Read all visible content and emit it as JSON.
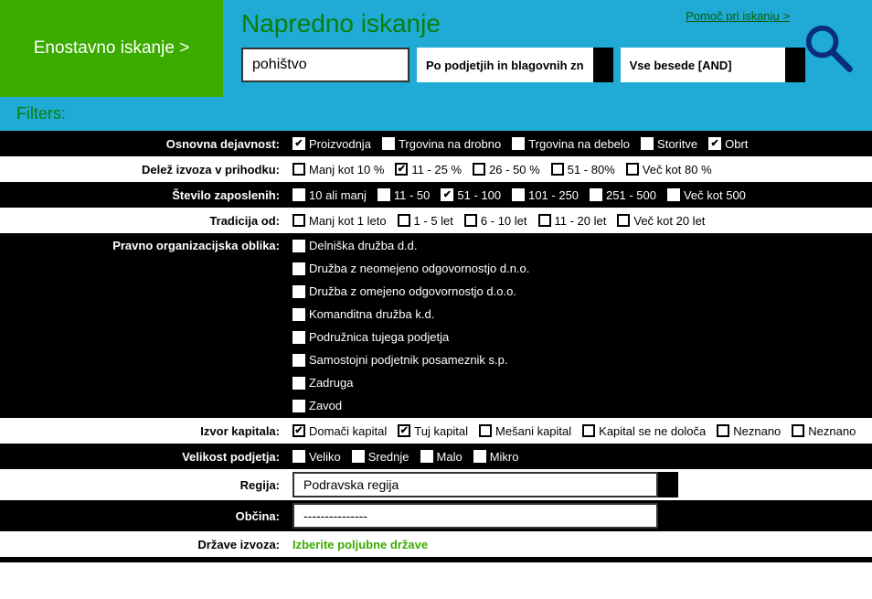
{
  "header": {
    "simple_search": "Enostavno iskanje >",
    "adv_title": "Napredno iskanje",
    "help": "Pomoč pri iskanju >",
    "search_value": "pohištvo",
    "scope": "Po podjetjih in blagovnih zn",
    "mode": "Vse besede [AND]"
  },
  "filters_label": "Filters:",
  "rows": [
    {
      "id": "osnovna",
      "dark": true,
      "label": "Osnovna dejavnost:",
      "opts": [
        {
          "l": "Proizvodnja",
          "c": true
        },
        {
          "l": "Trgovina na drobno",
          "c": false
        },
        {
          "l": "Trgovina na debelo",
          "c": false
        },
        {
          "l": "Storitve",
          "c": false
        },
        {
          "l": "Obrt",
          "c": true
        }
      ]
    },
    {
      "id": "delez",
      "dark": false,
      "label": "Delež izvoza v prihodku:",
      "opts": [
        {
          "l": "Manj kot 10 %",
          "c": false
        },
        {
          "l": "11 - 25 %",
          "c": true
        },
        {
          "l": "26 - 50 %",
          "c": false
        },
        {
          "l": "51 - 80%",
          "c": false
        },
        {
          "l": "Več kot 80 %",
          "c": false
        }
      ]
    },
    {
      "id": "stevilo",
      "dark": true,
      "label": "Število zaposlenih:",
      "opts": [
        {
          "l": "10 ali manj",
          "c": false
        },
        {
          "l": "11 - 50",
          "c": false
        },
        {
          "l": "51 - 100",
          "c": true
        },
        {
          "l": "101 - 250",
          "c": false
        },
        {
          "l": "251 - 500",
          "c": false
        },
        {
          "l": "Več kot 500",
          "c": false
        }
      ]
    },
    {
      "id": "tradicija",
      "dark": false,
      "label": "Tradicija od:",
      "opts": [
        {
          "l": "Manj kot 1 leto",
          "c": false
        },
        {
          "l": "1 - 5 let",
          "c": false
        },
        {
          "l": "6 - 10 let",
          "c": false
        },
        {
          "l": "11 - 20 let",
          "c": false
        },
        {
          "l": "Več kot 20 let",
          "c": false
        }
      ]
    },
    {
      "id": "pravno",
      "dark": true,
      "label": "Pravno organizacijska oblika:",
      "vertical": true,
      "opts": [
        {
          "l": "Delniška družba d.d.",
          "c": false
        },
        {
          "l": "Družba z neomejeno odgovornostjo d.n.o.",
          "c": false
        },
        {
          "l": "Družba z omejeno odgovornostjo d.o.o.",
          "c": false
        },
        {
          "l": "Komanditna družba k.d.",
          "c": false
        },
        {
          "l": "Podružnica tujega podjetja",
          "c": false
        },
        {
          "l": "Samostojni podjetnik posameznik s.p.",
          "c": false
        },
        {
          "l": "Zadruga",
          "c": false
        },
        {
          "l": "Zavod",
          "c": false
        }
      ]
    },
    {
      "id": "izvor",
      "dark": false,
      "label": "Izvor kapitala:",
      "opts": [
        {
          "l": "Domači kapital",
          "c": true
        },
        {
          "l": "Tuj kapital",
          "c": true
        },
        {
          "l": "Mešani kapital",
          "c": false
        },
        {
          "l": "Kapital se ne določa",
          "c": false
        },
        {
          "l": "Neznano",
          "c": false
        },
        {
          "l": "Neznano",
          "c": false
        }
      ]
    },
    {
      "id": "velikost",
      "dark": true,
      "label": "Velikost podjetja:",
      "opts": [
        {
          "l": "Veliko",
          "c": false
        },
        {
          "l": "Srednje",
          "c": false
        },
        {
          "l": "Malo",
          "c": false
        },
        {
          "l": "Mikro",
          "c": false
        }
      ]
    }
  ],
  "region": {
    "label": "Regija:",
    "value": "Podravska regija"
  },
  "obcina": {
    "label": "Občina:",
    "value": "---------------"
  },
  "drzave": {
    "label": "Države izvoza:",
    "action": "Izberite poljubne države"
  }
}
